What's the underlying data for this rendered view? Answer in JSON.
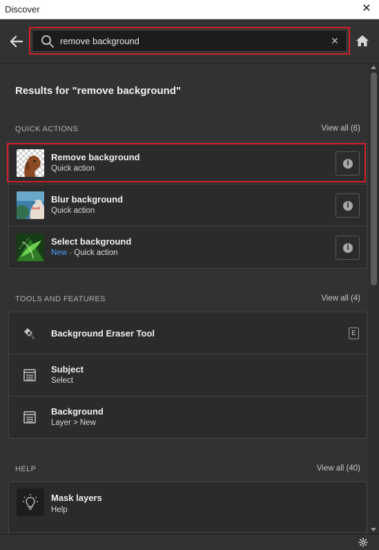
{
  "window": {
    "title": "Discover"
  },
  "search": {
    "query": "remove background"
  },
  "results_title": "Results for \"remove background\"",
  "quick_actions": {
    "label": "QUICK ACTIONS",
    "view_all": "View all (6)",
    "items": [
      {
        "title": "Remove background",
        "subtitle": "Quick action"
      },
      {
        "title": "Blur background",
        "subtitle": "Quick action"
      },
      {
        "title": "Select background",
        "badge": "New",
        "subtitle": "· Quick action"
      }
    ]
  },
  "tools": {
    "label": "TOOLS AND FEATURES",
    "view_all": "View all (4)",
    "items": [
      {
        "title": "Background Eraser Tool",
        "shortcut": "E"
      },
      {
        "title": "Subject",
        "subtitle": "Select"
      },
      {
        "title": "Background",
        "subtitle": "Layer > New"
      }
    ]
  },
  "help": {
    "label": "HELP",
    "view_all": "View all (40)",
    "items": [
      {
        "title": "Mask layers",
        "subtitle": "Help"
      }
    ]
  },
  "icons": {
    "back": "arrow-left-icon",
    "search": "search-icon",
    "clear": "close-icon",
    "home": "home-icon",
    "info": "info-icon",
    "eraser": "background-eraser-icon",
    "menu": "menu-icon",
    "lightbulb": "lightbulb-icon",
    "settings": "gear-icon"
  },
  "colors": {
    "highlight": "#d5202a",
    "new_badge": "#4a9eff",
    "panel": "#323232"
  }
}
